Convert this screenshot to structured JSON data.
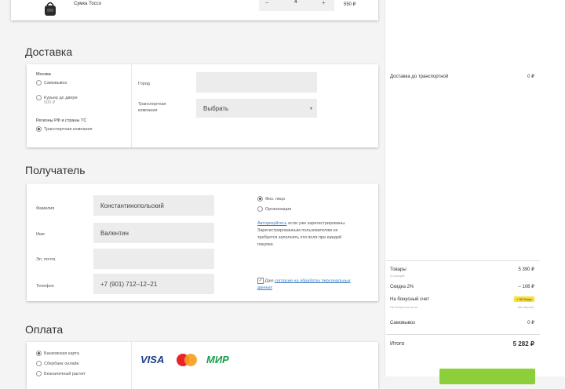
{
  "cart": {
    "item_name": "Сумка Тоссо",
    "qty_minus": "−",
    "qty": "4",
    "qty_plus": "+",
    "price": "550 ₽"
  },
  "delivery": {
    "title": "Доставка",
    "moscow_label": "Москва",
    "pickup": "Самовывоз",
    "courier": "Курьер до двери",
    "courier_note": "500 ₽",
    "regions_label": "Регионы РФ и страны ТС",
    "transport": "Транспортная компания",
    "city_label": "Город",
    "city_value": "",
    "tc_label": "Транспортная компания",
    "tc_select": "Выбрать",
    "tc_chevron": "▾"
  },
  "recipient": {
    "title": "Получатель",
    "surname_label": "Фамилия",
    "surname_value": "Константинопольский",
    "name_label": "Имя",
    "name_value": "Валентин",
    "email_label": "Эл. почта",
    "email_value": "",
    "phone_label": "Телефон",
    "phone_value": "+7 (901) 712–12–21",
    "person_phys": "Физ. лицо",
    "person_org": "Организация",
    "auth_link": "Авторизуйтесь",
    "auth_text": "если уже зарегистрированы. Зарегистрированным пользователям не требуется заполнять эти поля при каждой покупке.",
    "consent_text": "Даю",
    "consent_link": "согласие на обработку персональных данных"
  },
  "payment": {
    "title": "Оплата",
    "bank_card": "Банковская карта",
    "sberbank": "Сбербанк онлайн",
    "cashless": "Безналичный расчет",
    "visa": "VISA",
    "mir": "МИР"
  },
  "summary": {
    "delivery_label": "Доставка до транспортной",
    "delivery_value": "0 ₽",
    "goods_label": "Товары",
    "goods_sub": "5 позиций",
    "goods_value": "5 390 ₽",
    "discount_label": "Скидка 2%",
    "discount_value": "– 108 ₽",
    "bonus_label": "На бонусный счет",
    "bonus_sub": "На бонусном счете",
    "bonus_sub2": "Вас баланс",
    "bonus_badge": "+ 55 бонус",
    "pickup_label": "Самовывоз",
    "pickup_value": "0 ₽",
    "total_label": "Итого",
    "total_value": "5 282 ₽"
  },
  "colors": {
    "accent_green": "#8dcf3a",
    "link_blue": "#3a7fc1",
    "badge_yellow": "#f6e03a"
  }
}
